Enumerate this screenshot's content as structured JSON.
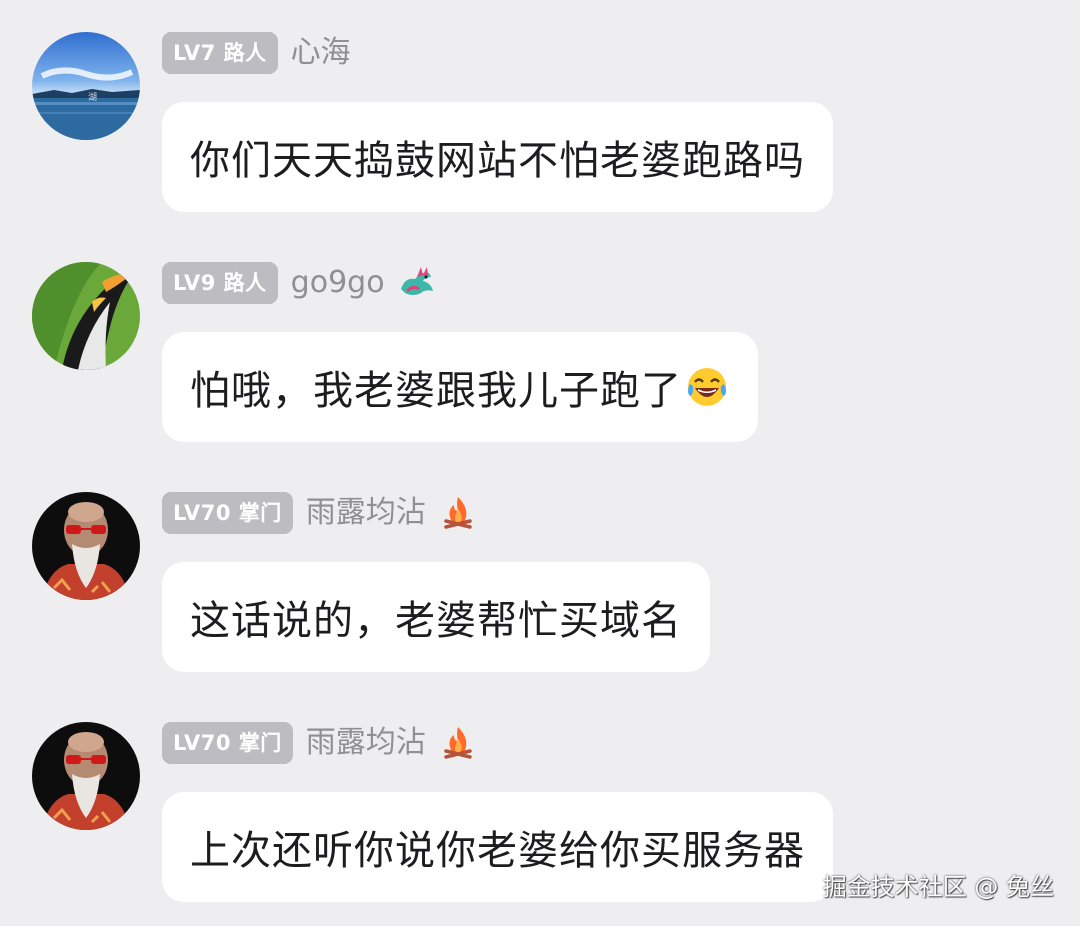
{
  "colors": {
    "page_background": "#eeeef0",
    "bubble_background": "#ffffff",
    "level_badge_background": "#bdbdc1",
    "username_color": "#8f8f94",
    "message_text_color": "#1d1d1f"
  },
  "comments": [
    {
      "avatar_icon": "lake-landscape-avatar",
      "level_badge": "LV7 路人",
      "username": "心海",
      "user_icon": null,
      "text": "你们天天捣鼓网站不怕老婆跑路吗",
      "trailing_emoji": null
    },
    {
      "avatar_icon": "penguin-avatar",
      "level_badge": "LV9 路人",
      "username": "go9go",
      "user_icon": "dragon-icon",
      "text": "怕哦，我老婆跟我儿子跑了",
      "trailing_emoji": "tears-of-joy-emoji"
    },
    {
      "avatar_icon": "bald-man-sunglasses-avatar",
      "level_badge": "LV70 掌门",
      "username": "雨露均沾",
      "user_icon": "campfire-icon",
      "text": "这话说的，老婆帮忙买域名",
      "trailing_emoji": null
    },
    {
      "avatar_icon": "bald-man-sunglasses-avatar",
      "level_badge": "LV70 掌门",
      "username": "雨露均沾",
      "user_icon": "campfire-icon",
      "text": "上次还听你说你老婆给你买服务器",
      "trailing_emoji": null
    }
  ],
  "watermark": "掘金技术社区 @ 兔丝"
}
